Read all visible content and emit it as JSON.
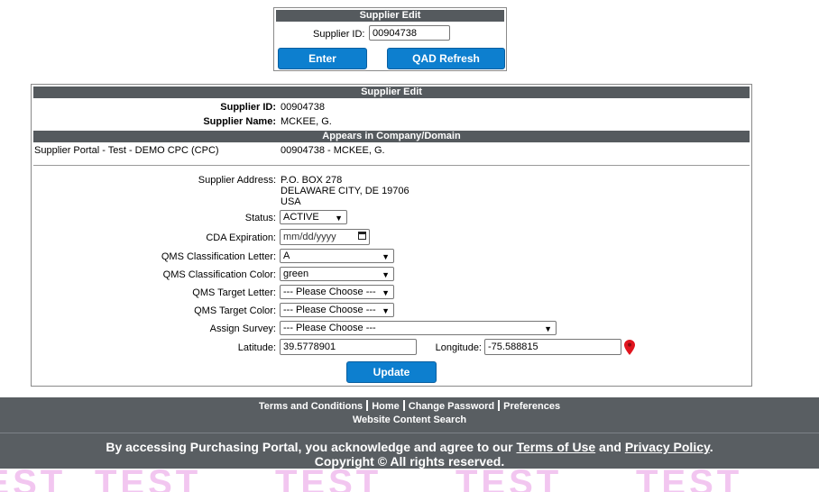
{
  "top_box": {
    "title": "Supplier Edit",
    "supplier_id_label": "Supplier ID:",
    "supplier_id_value": "00904738",
    "enter_label": "Enter",
    "qad_refresh_label": "QAD Refresh"
  },
  "main": {
    "title": "Supplier Edit",
    "supplier_id_label": "Supplier ID:",
    "supplier_id_value": "00904738",
    "supplier_name_label": "Supplier Name:",
    "supplier_name_value": "MCKEE, G.",
    "appears_header": "Appears in Company/Domain",
    "company_domain": "Supplier Portal - Test - DEMO CPC (CPC)",
    "company_supplier": "00904738 - MCKEE, G.",
    "address_label": "Supplier Address:",
    "address_lines": [
      "P.O. BOX 278",
      "DELAWARE CITY, DE 19706",
      "USA"
    ],
    "status_label": "Status:",
    "status_value": "ACTIVE",
    "cda_label": "CDA Expiration:",
    "cda_placeholder": "mm/dd/yyyy",
    "qms_letter_label": "QMS Classification Letter:",
    "qms_letter_value": "A",
    "qms_color_label": "QMS Classification Color:",
    "qms_color_value": "green",
    "target_letter_label": "QMS Target Letter:",
    "target_letter_value": "--- Please Choose ---",
    "target_color_label": "QMS Target Color:",
    "target_color_value": "--- Please Choose ---",
    "survey_label": "Assign Survey:",
    "survey_value": "--- Please Choose ---",
    "latitude_label": "Latitude:",
    "latitude_value": "39.5778901",
    "longitude_label": "Longitude:",
    "longitude_value": "-75.588815",
    "update_label": "Update"
  },
  "footer": {
    "links": [
      "Terms and Conditions",
      "Home",
      "Change Password",
      "Preferences"
    ],
    "search_link": "Website Content Search",
    "legal_prefix": "By accessing Purchasing Portal, you acknowledge and agree to our ",
    "terms_link": "Terms of Use",
    "and_text": " and ",
    "privacy_link": "Privacy Policy",
    "period": ".",
    "copyright": "Copyright © All rights reserved."
  },
  "watermark": {
    "text": "TEST"
  },
  "colors": {
    "header_bg": "#555a5e",
    "button_bg": "#0d7fcf",
    "footer_bg": "#595e62",
    "marker": "#e0141e",
    "watermark": "#f2c6f0"
  }
}
